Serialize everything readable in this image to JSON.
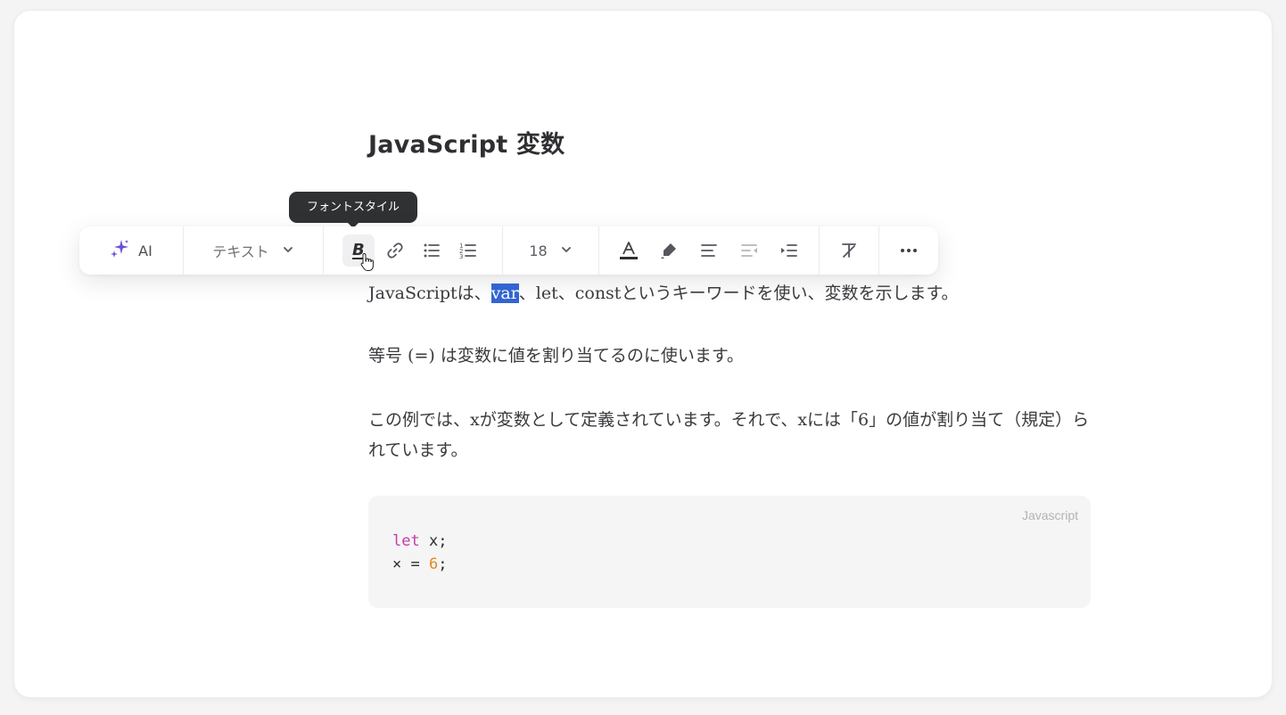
{
  "document": {
    "title": "JavaScript 変数",
    "paragraph1": {
      "before": "JavaScriptは、",
      "selected": "var",
      "after": "、let、constというキーワードを使い、変数を示します。"
    },
    "paragraph2": "等号 (=) は変数に値を割り当てるのに使います。",
    "paragraph3": "この例では、xが変数として定義されています。それで、xには「6」の値が割り当て（規定）られています。"
  },
  "tooltip": {
    "text": "フォントスタイル"
  },
  "toolbar": {
    "ai_label": "AI",
    "text_style_label": "テキスト",
    "font_size": "18",
    "accent_color": "#6b4fd8",
    "buttons": [
      "sparkle-icon",
      "chevron-down-icon",
      "bold-icon",
      "link-icon",
      "bullet-list-icon",
      "numbered-list-icon",
      "font-color-icon",
      "highlighter-icon",
      "align-left-icon",
      "outdent-icon",
      "indent-icon",
      "clear-format-icon",
      "more-icon"
    ]
  },
  "code_block": {
    "language": "Javascript",
    "line1": {
      "keyword": "let",
      "rest": " x;"
    },
    "line2": {
      "var": "×",
      "op": " = ",
      "num": "6",
      "end": ";"
    }
  },
  "colors": {
    "selection": "#3265d1",
    "keyword": "#c33ca7",
    "number": "#e08a1f"
  }
}
